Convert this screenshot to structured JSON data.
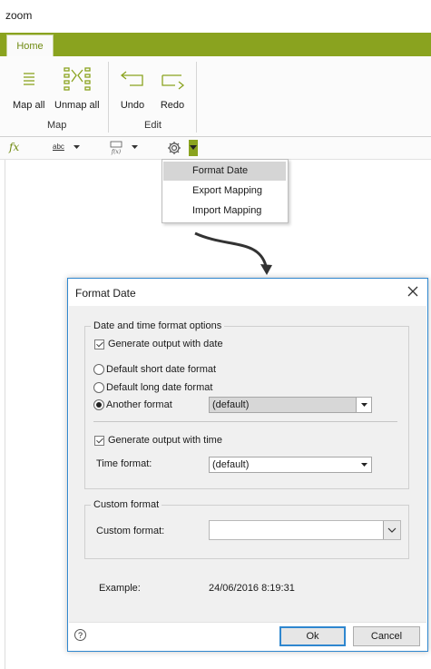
{
  "window": {
    "title": "zoom"
  },
  "ribbon": {
    "tab": "Home",
    "groups": [
      {
        "label": "Map",
        "buttons": [
          {
            "label": "Map all",
            "icon": "map-all-icon"
          },
          {
            "label": "Unmap all",
            "icon": "unmap-all-icon"
          }
        ]
      },
      {
        "label": "Edit",
        "buttons": [
          {
            "label": "Undo",
            "icon": "undo-icon"
          },
          {
            "label": "Redo",
            "icon": "redo-icon"
          }
        ]
      }
    ]
  },
  "toolbar": {
    "fx": "fx",
    "abc": "abc",
    "fmt": "fmt"
  },
  "menu": {
    "items": [
      "Format Date",
      "Export Mapping",
      "Import Mapping"
    ],
    "selected": "Format Date"
  },
  "dialog": {
    "title": "Format Date",
    "group1": {
      "legend": "Date and time format options",
      "gen_date": "Generate output with date",
      "short": "Default short date format",
      "long": "Default long date format",
      "another": "Another format",
      "another_value": "(default)",
      "gen_time": "Generate output with time",
      "time_label": "Time format:",
      "time_value": "(default)"
    },
    "group2": {
      "legend": "Custom format",
      "label": "Custom format:",
      "value": ""
    },
    "example": {
      "label": "Example:",
      "value": "24/06/2016 8:19:31"
    },
    "buttons": {
      "ok": "Ok",
      "cancel": "Cancel",
      "help": "?"
    }
  },
  "colors": {
    "accent": "#8aa31f",
    "dialog_border": "#2f87cf"
  }
}
